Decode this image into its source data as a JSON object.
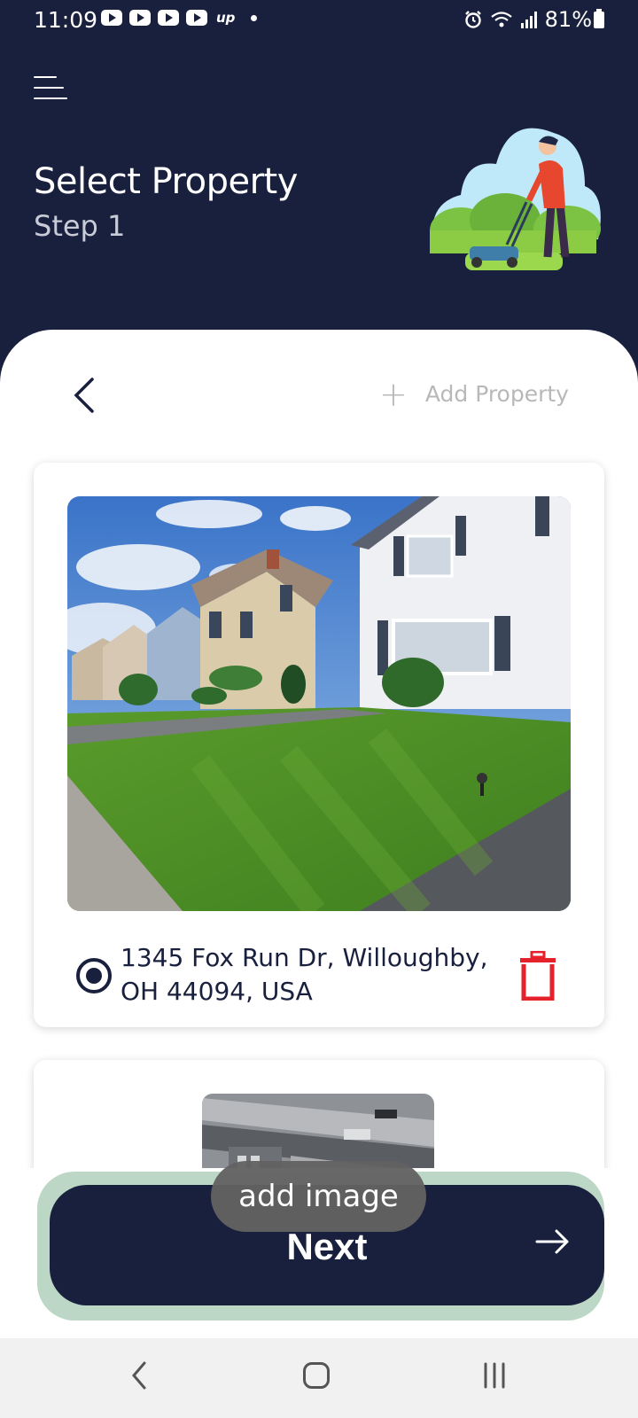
{
  "status_bar": {
    "time": "11:09",
    "notification_icons": [
      "youtube-icon",
      "youtube-icon",
      "youtube-icon",
      "youtube-icon",
      "upwork-icon",
      "dot-icon"
    ],
    "upwork_text": "up",
    "status_icons": [
      "alarm-icon",
      "wifi-icon",
      "signal-icon",
      "battery-icon"
    ],
    "battery": "81%"
  },
  "header": {
    "menu_icon": "menu-icon",
    "title": "Select Property",
    "step": "Step 1",
    "illustration": "person mowing lawn"
  },
  "toolbar": {
    "back_icon": "chevron-left-icon",
    "add_property_icon": "plus-icon",
    "add_property_label": "Add Property"
  },
  "properties": [
    {
      "image": "house with lawn photo",
      "address": "1345 Fox Run Dr, Willoughby, OH 44094, USA",
      "selected": true,
      "delete_icon": "trash-icon"
    },
    {
      "image": "aerial rooftop photo"
    }
  ],
  "next_button": {
    "label": "Next",
    "icon": "arrow-right-icon"
  },
  "toast": {
    "message": "add image"
  },
  "nav_bar": {
    "icons": [
      "back-icon",
      "home-icon",
      "recents-icon"
    ]
  },
  "colors": {
    "navy": "#19203d",
    "delete_red": "#e5212b",
    "button_shadow": "#bcd7c5",
    "muted_text": "#b8b8b8"
  }
}
